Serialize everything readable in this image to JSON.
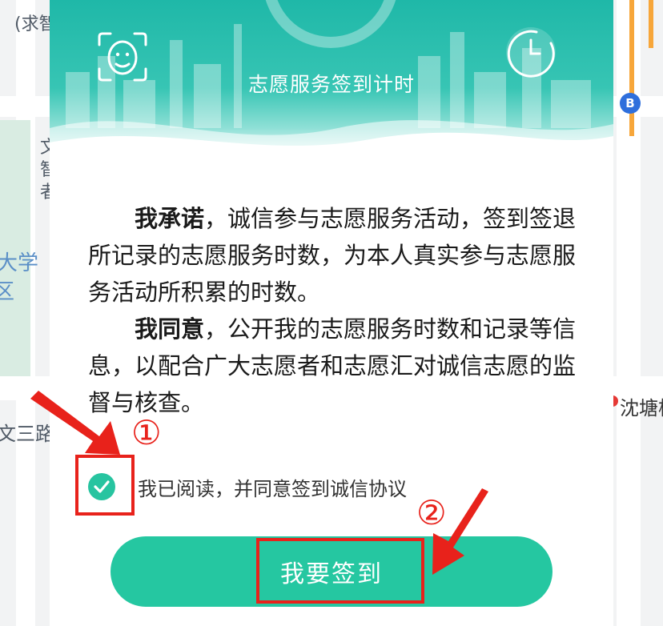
{
  "map": {
    "labels": {
      "top_left": "(求智",
      "char_1": "文",
      "char_2": "智",
      "char_3": "者",
      "district_a": "大学",
      "district_b": "区",
      "road": "文三路",
      "station": "沈塘桥"
    },
    "bus_badge": "B"
  },
  "dialog": {
    "header_title": "志愿服务签到计时",
    "pledge_1_bold": "我承诺",
    "pledge_1_text": "，诚信参与志愿服务活动，签到签退所记录的志愿服务时数，为本人真实参与志愿服务活动所积累的时数。",
    "pledge_2_bold": "我同意",
    "pledge_2_text": "，公开我的志愿服务时数和记录等信息，以配合广大志愿者和志愿汇对诚信志愿的监督与核查。",
    "agree_label": "我已阅读，并同意签到诚信协议",
    "agree_checked": true,
    "signin_button": "我要签到"
  },
  "annotations": {
    "step_1": "①",
    "step_2": "②",
    "color": "#e8221b"
  },
  "colors": {
    "primary": "#25c7a1",
    "header": "#1fb8a8"
  }
}
